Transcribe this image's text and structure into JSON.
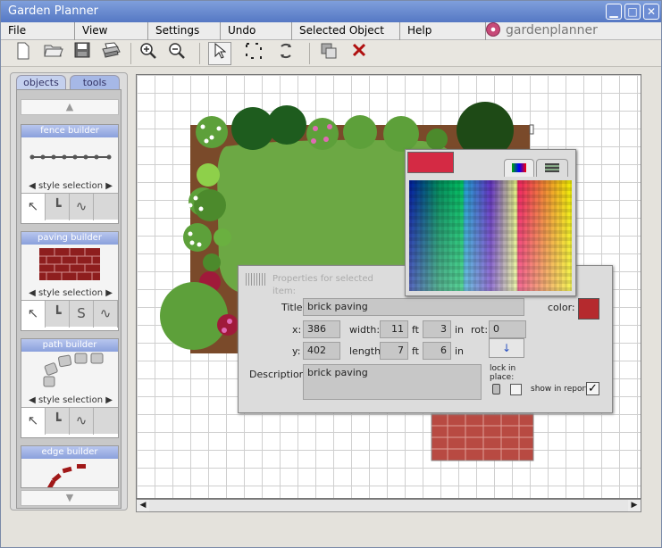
{
  "window": {
    "title": "Garden Planner"
  },
  "menu": [
    "File",
    "View",
    "Settings",
    "Undo",
    "Selected Object",
    "Help"
  ],
  "logo": "gardenplanner",
  "toolbar": [
    "new-icon",
    "open-icon",
    "save-icon",
    "print-icon",
    "zoom-in-icon",
    "zoom-out-icon",
    "select-arrow-icon",
    "marquee-select-icon",
    "rotate-icon",
    "bring-to-front-icon",
    "delete-icon"
  ],
  "panel": {
    "tabs": [
      "objects",
      "tools"
    ],
    "active_tab": "tools",
    "builders": [
      {
        "title": "fence builder",
        "style": "style selection"
      },
      {
        "title": "paving builder",
        "style": "style selection"
      },
      {
        "title": "path builder",
        "style": "style selection"
      },
      {
        "title": "edge builder"
      }
    ]
  },
  "props": {
    "header": "Properties for selected item:",
    "title_label": "Title:",
    "title_value": "brick paving",
    "color_label": "color:",
    "color": "#b52a2e",
    "x_label": "x:",
    "x_value": "386",
    "y_label": "y:",
    "y_value": "402",
    "width_label": "width:",
    "width_ft": "11",
    "width_in": "3",
    "length_label": "length:",
    "length_ft": "7",
    "length_in": "6",
    "ft_unit": "ft",
    "in_unit": "in",
    "rot_label": "rot:",
    "rot_value": "0",
    "description_label": "Description:",
    "description_value": "brick paving",
    "lock_label": "lock in place:",
    "show_label": "show in report:",
    "lock_checked": false,
    "show_checked": true
  },
  "palette": {
    "current_color": "#d42a44",
    "tabs": [
      "spectrum-icon",
      "swatches-icon"
    ]
  },
  "colors": {
    "lawn": "#6ca844",
    "brick": "#b84a42",
    "soil": "#7a4a2a",
    "accent": "#5578c4"
  }
}
